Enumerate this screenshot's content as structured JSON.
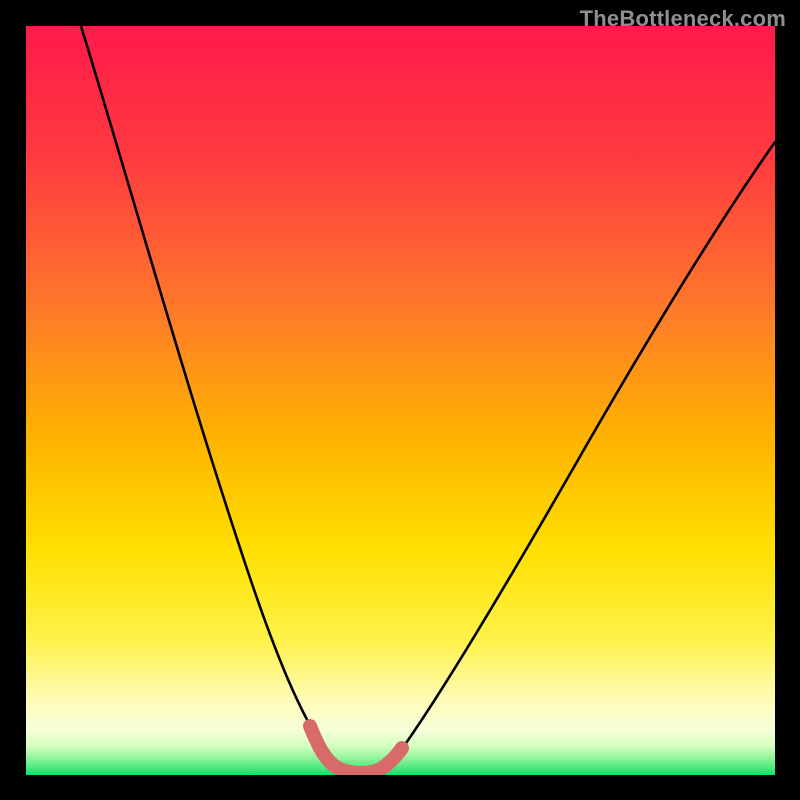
{
  "watermark": {
    "text": "TheBottleneck.com"
  },
  "colors": {
    "page_bg": "#000000",
    "gradient_top": "#ff1a4b",
    "gradient_mid1": "#ff7a2a",
    "gradient_mid2": "#ffd400",
    "gradient_mid3": "#fffb9a",
    "gradient_bottom": "#00e56a",
    "curve_stroke": "#000000",
    "highlight_stroke": "#d86b6a"
  },
  "chart_data": {
    "type": "line",
    "title": "",
    "xlabel": "",
    "ylabel": "",
    "xlim": [
      0,
      100
    ],
    "ylim": [
      0,
      100
    ],
    "grid": false,
    "legend": false,
    "series": [
      {
        "name": "bottleneck_curve",
        "x": [
          0,
          5,
          10,
          15,
          20,
          25,
          28,
          30,
          32,
          34,
          36,
          38,
          40,
          42,
          44,
          46,
          50,
          55,
          60,
          65,
          70,
          75,
          80,
          85,
          90,
          95,
          100
        ],
        "y": [
          100,
          88,
          76,
          64,
          52,
          38,
          28,
          21,
          15,
          10,
          6,
          3,
          1,
          0,
          0,
          1,
          4,
          9,
          15,
          22,
          29,
          36,
          43,
          50,
          57,
          64,
          71
        ]
      }
    ],
    "highlight_zone": {
      "x_range": [
        37,
        47
      ],
      "y_band": [
        0,
        5
      ]
    }
  }
}
